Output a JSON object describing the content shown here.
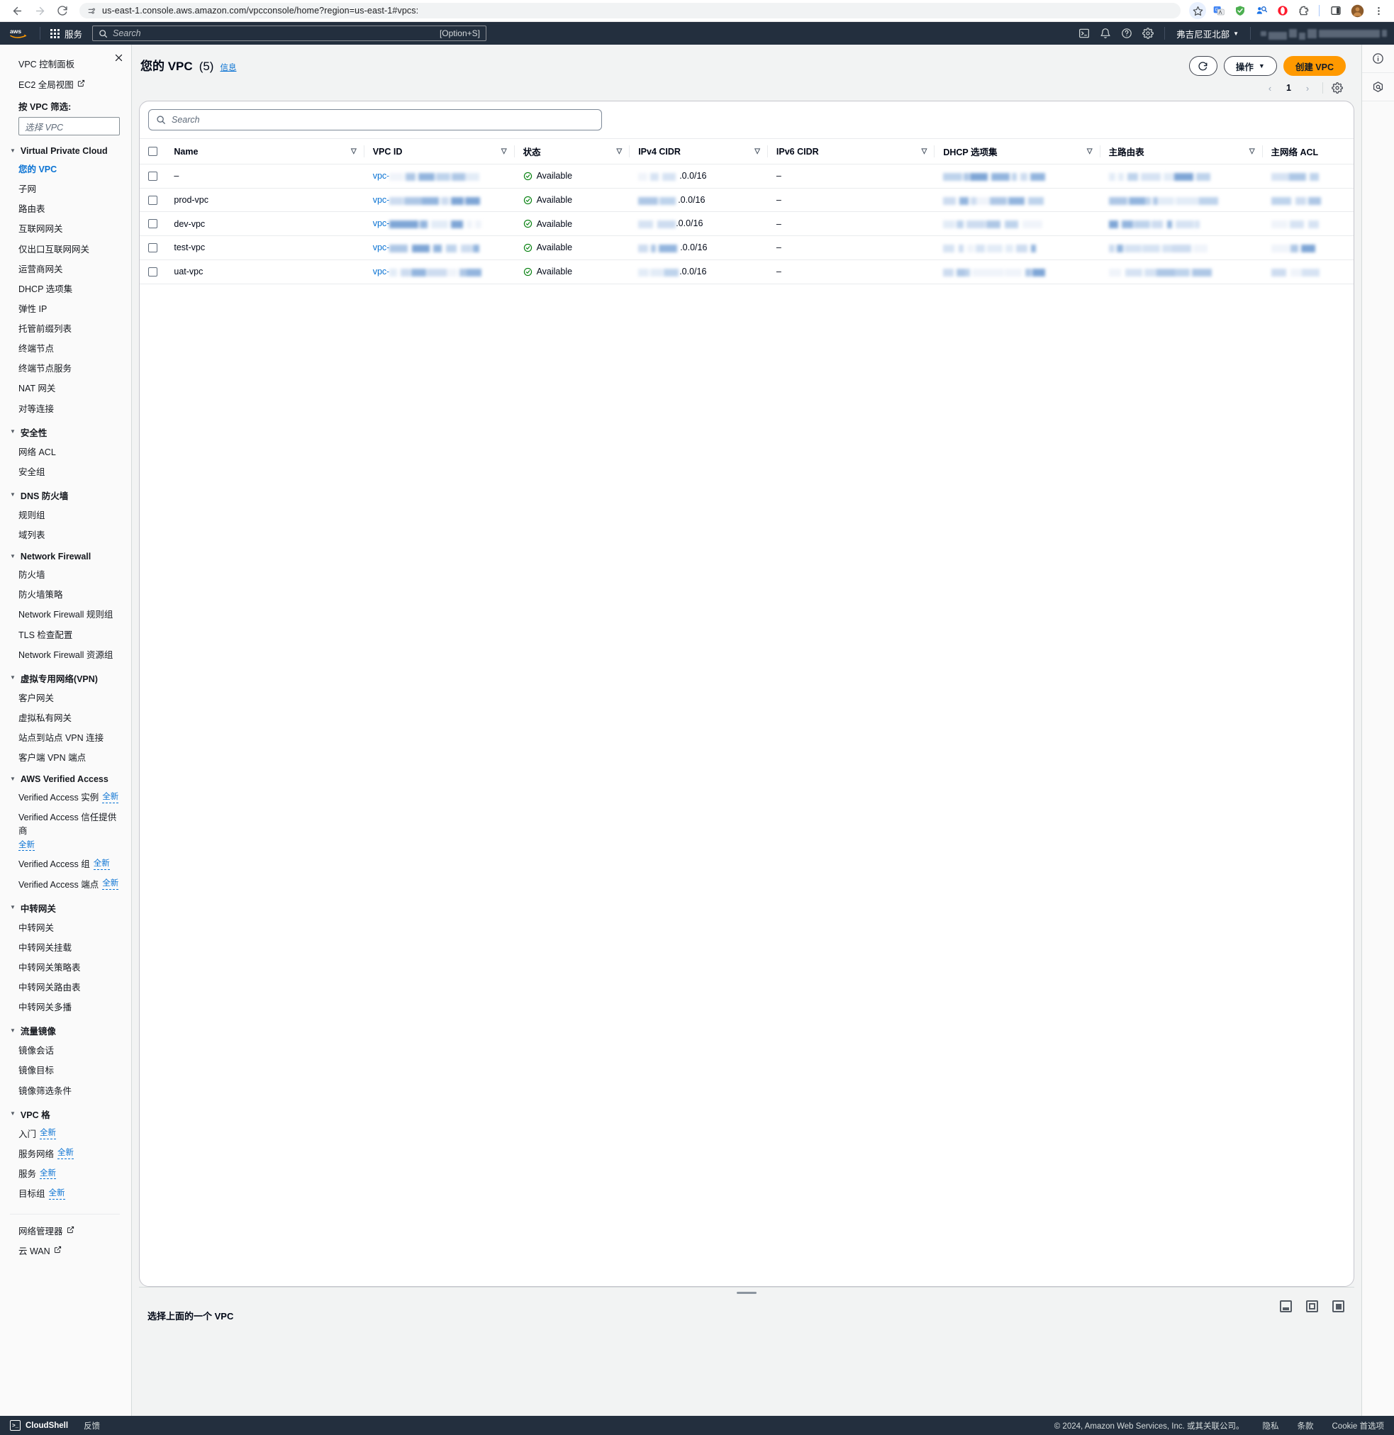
{
  "browser": {
    "url": "us-east-1.console.aws.amazon.com/vpcconsole/home?region=us-east-1#vpcs:",
    "back_icon": "back-arrow-icon",
    "forward_icon": "forward-arrow-icon",
    "reload_icon": "reload-icon",
    "site_info_icon": "site-settings-icon",
    "bookmark_icon": "star-icon",
    "extensions": [
      "translate-icon",
      "shield-icon",
      "contacts-icon",
      "opera-icon",
      "puzzle-icon",
      "sidepanel-icon",
      "avatar-icon",
      "kebab-menu-icon"
    ]
  },
  "awsnav": {
    "logo": "aws-logo",
    "services_label": "服务",
    "search_placeholder": "Search",
    "search_hint": "[Option+S]",
    "icons": [
      "cloudshell-icon",
      "notifications-bell-icon",
      "help-question-icon",
      "settings-gear-icon"
    ],
    "region_label": "弗吉尼亚北部",
    "account_label": ""
  },
  "sidebar": {
    "close_icon": "close-icon",
    "top_links": [
      {
        "label": "VPC 控制面板",
        "external": false
      },
      {
        "label": "EC2 全局视图",
        "external": true
      }
    ],
    "filter_label": "按 VPC 筛选:",
    "filter_placeholder": "选择 VPC",
    "groups": [
      {
        "title": "Virtual Private Cloud",
        "items": [
          {
            "label": "您的 VPC",
            "active": true
          },
          {
            "label": "子网"
          },
          {
            "label": "路由表"
          },
          {
            "label": "互联网网关"
          },
          {
            "label": "仅出口互联网网关"
          },
          {
            "label": "运营商网关"
          },
          {
            "label": "DHCP 选项集"
          },
          {
            "label": "弹性 IP"
          },
          {
            "label": "托管前缀列表"
          },
          {
            "label": "终端节点"
          },
          {
            "label": "终端节点服务"
          },
          {
            "label": "NAT 网关"
          },
          {
            "label": "对等连接"
          }
        ]
      },
      {
        "title": "安全性",
        "items": [
          {
            "label": "网络 ACL"
          },
          {
            "label": "安全组"
          }
        ]
      },
      {
        "title": "DNS 防火墙",
        "items": [
          {
            "label": "规则组"
          },
          {
            "label": "域列表"
          }
        ]
      },
      {
        "title": "Network Firewall",
        "items": [
          {
            "label": "防火墙"
          },
          {
            "label": "防火墙策略"
          },
          {
            "label": "Network Firewall 规则组"
          },
          {
            "label": "TLS 检查配置"
          },
          {
            "label": "Network Firewall 资源组"
          }
        ]
      },
      {
        "title": "虚拟专用网络(VPN)",
        "items": [
          {
            "label": "客户网关"
          },
          {
            "label": "虚拟私有网关"
          },
          {
            "label": "站点到站点 VPN 连接"
          },
          {
            "label": "客户端 VPN 端点"
          }
        ]
      },
      {
        "title": "AWS Verified Access",
        "items": [
          {
            "label": "Verified Access 实例",
            "badge": "全新"
          },
          {
            "label": "Verified Access 信任提供商",
            "badge": "全新"
          },
          {
            "label": "Verified Access 组",
            "badge": "全新"
          },
          {
            "label": "Verified Access 端点",
            "badge": "全新"
          }
        ]
      },
      {
        "title": "中转网关",
        "items": [
          {
            "label": "中转网关"
          },
          {
            "label": "中转网关挂载"
          },
          {
            "label": "中转网关策略表"
          },
          {
            "label": "中转网关路由表"
          },
          {
            "label": "中转网关多播"
          }
        ]
      },
      {
        "title": "流量镜像",
        "items": [
          {
            "label": "镜像会话"
          },
          {
            "label": "镜像目标"
          },
          {
            "label": "镜像筛选条件"
          }
        ]
      },
      {
        "title": "VPC 格",
        "items": [
          {
            "label": "入门",
            "badge": "全新"
          },
          {
            "label": "服务网络",
            "badge": "全新"
          },
          {
            "label": "服务",
            "badge": "全新"
          },
          {
            "label": "目标组",
            "badge": "全新"
          }
        ]
      }
    ],
    "bottom_links": [
      {
        "label": "网络管理器",
        "external": true
      },
      {
        "label": "云 WAN",
        "external": true
      }
    ]
  },
  "page": {
    "title": "您的 VPC",
    "count": "(5)",
    "info_link": "信息",
    "refresh_icon": "refresh-icon",
    "actions_label": "操作",
    "create_label": "创建 VPC",
    "pager": {
      "prev_icon": "chevron-left-icon",
      "page": "1",
      "next_icon": "chevron-right-icon",
      "settings_icon": "gear-icon"
    },
    "table_search_placeholder": "Search"
  },
  "table": {
    "columns": [
      "Name",
      "VPC ID",
      "状态",
      "IPv4 CIDR",
      "IPv6 CIDR",
      "DHCP 选项集",
      "主路由表",
      "主网络 ACL"
    ],
    "rows": [
      {
        "name": "–",
        "vpc_id_prefix": "vpc-",
        "status": "Available",
        "ipv4": ".0.0/16",
        "ipv6": "–"
      },
      {
        "name": "prod-vpc",
        "vpc_id_prefix": "vpc-",
        "status": "Available",
        "ipv4": ".0.0/16",
        "ipv6": "–"
      },
      {
        "name": "dev-vpc",
        "vpc_id_prefix": "vpc-",
        "status": "Available",
        "ipv4": ".0.0/16",
        "ipv6": "–"
      },
      {
        "name": "test-vpc",
        "vpc_id_prefix": "vpc-",
        "status": "Available",
        "ipv4": ".0.0/16",
        "ipv6": "–"
      },
      {
        "name": "uat-vpc",
        "vpc_id_prefix": "vpc-",
        "status": "Available",
        "ipv4": ".0.0/16",
        "ipv6": "–"
      }
    ]
  },
  "split_panel": {
    "title": "选择上面的一个 VPC",
    "view_icons": [
      "panel-bottom-icon",
      "panel-side-icon",
      "panel-full-icon"
    ]
  },
  "right_rail": {
    "icons": [
      "info-circle-icon",
      "shield-hex-icon"
    ]
  },
  "footer": {
    "cloudshell_label": "CloudShell",
    "feedback_label": "反馈",
    "copyright": "© 2024, Amazon Web Services, Inc. 或其关联公司。",
    "links": [
      "隐私",
      "条款",
      "Cookie 首选项"
    ]
  },
  "colors": {
    "aws_navy": "#232f3e",
    "aws_orange": "#ff9900",
    "link_blue": "#0972d3",
    "status_green": "#037f0c"
  }
}
